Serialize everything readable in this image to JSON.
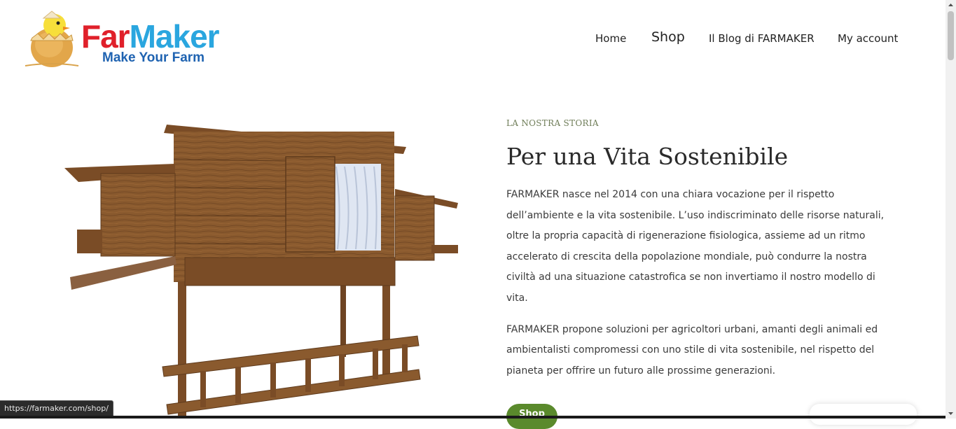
{
  "header": {
    "logo": {
      "brand_part1": "Far",
      "brand_part2": "Maker",
      "tagline": "Make Your Farm"
    },
    "nav": [
      {
        "label": "Home"
      },
      {
        "label": "Shop"
      },
      {
        "label": "Il Blog di FARMAKER"
      },
      {
        "label": "My account"
      }
    ]
  },
  "main": {
    "eyebrow": "LA NOSTRA STORIA",
    "title": "Per una Vita Sostenibile",
    "paragraphs": [
      "FARMAKER nasce nel 2014 con una chiara vocazione per il rispetto dell’ambiente e la vita sostenibile. L’uso indiscriminato delle risorse naturali, oltre la propria capacità di rigenerazione fisiologica, assieme ad un ritmo accelerato di crescita della popolazione mondiale, può condurre la nostra civiltà ad una situazione catastrofica se non invertiamo il nostro modello di vita.",
      "FARMAKER propone soluzioni per agricoltori urbani, amanti degli animali ed ambientalisti compromessi con uno stile di vita sostenibile, nel rispetto del pianeta per offrire un futuro alle prossime generazioni."
    ],
    "button_label": "Shop",
    "image": {
      "alt": "Pollaio in legno"
    }
  },
  "status_bar": {
    "url": "https://farmaker.com/shop/"
  },
  "colors": {
    "brand_red": "#e0202a",
    "brand_blue": "#2aa6df",
    "tagline_blue": "#1f63b1",
    "eyebrow_green": "#6f7d58",
    "button_green": "#5a8a2c",
    "wood": "#8a5a2e"
  },
  "icons": {
    "logo_mascot": "chick-in-egg-icon",
    "scroll_up": "arrow-up-icon",
    "scroll_down": "arrow-down-icon"
  }
}
